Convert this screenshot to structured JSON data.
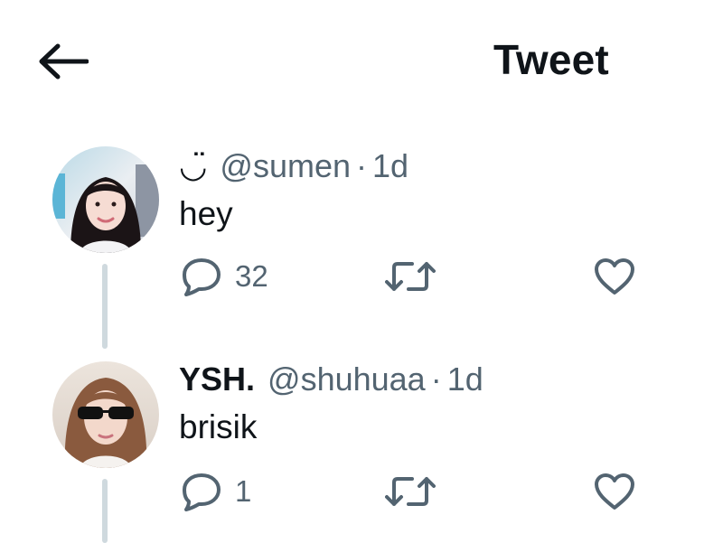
{
  "header": {
    "title": "Tweet",
    "back_icon": "arrow-left-icon"
  },
  "colors": {
    "text": "#0f1419",
    "secondary": "#536471",
    "thread_line": "#cfd9de",
    "background": "#ffffff"
  },
  "tweets": [
    {
      "display_name": "◡̈",
      "handle": "@sumen",
      "separator": "·",
      "time": "1d",
      "text": "hey",
      "reply_count": "32",
      "avatar_icon": "avatar"
    },
    {
      "display_name": "YSH.",
      "handle": "@shuhuaa",
      "separator": "·",
      "time": "1d",
      "text": "brisik",
      "reply_count": "1",
      "avatar_icon": "avatar"
    }
  ]
}
